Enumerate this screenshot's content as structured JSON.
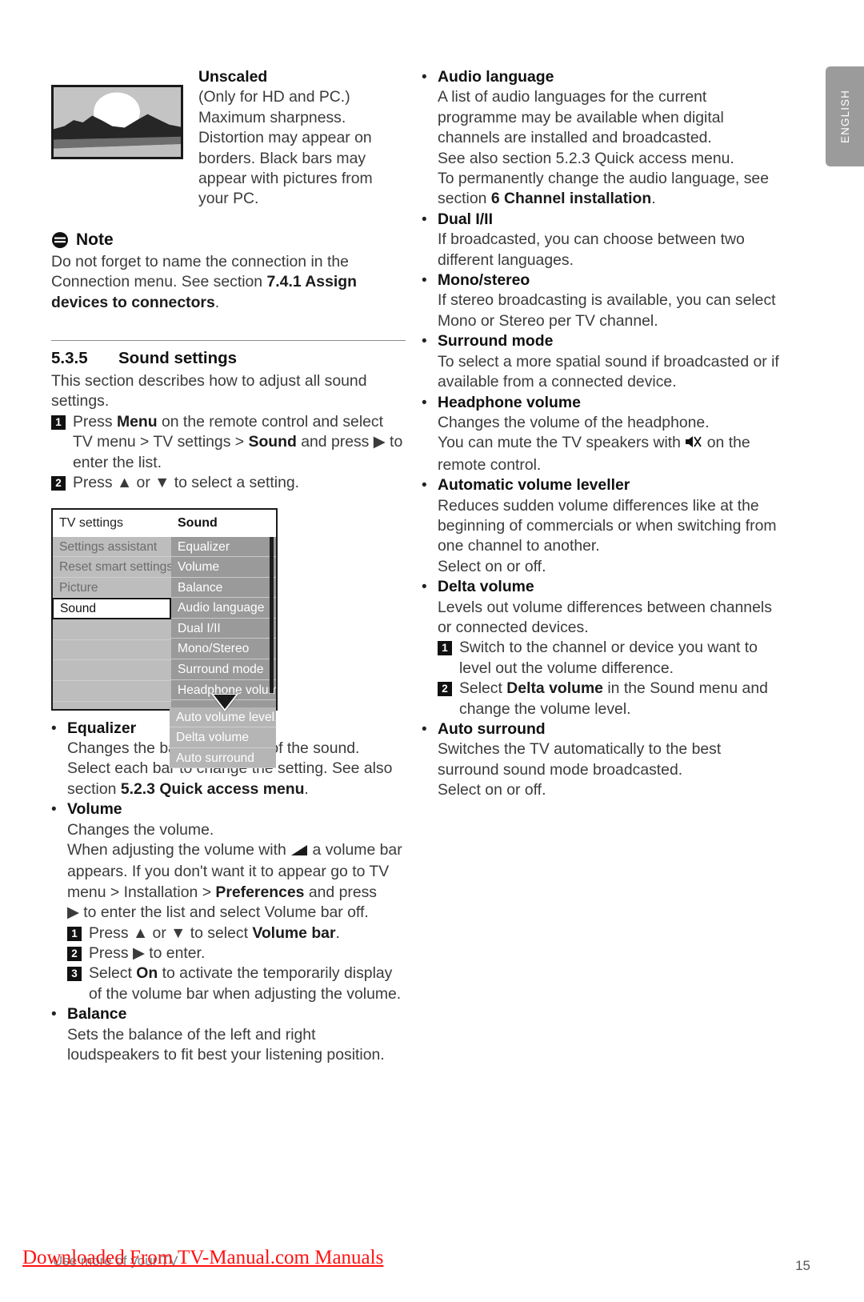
{
  "language_tab": {
    "label": "ENGLISH"
  },
  "left_column": {
    "unscaled": {
      "title": "Unscaled",
      "lines": [
        "(Only for HD and PC.)",
        "Maximum sharpness.",
        "Distortion may appear on",
        "borders. Black bars may",
        "appear with pictures from",
        "your PC."
      ]
    },
    "note": {
      "title": "Note",
      "text_before": "Do not forget to name the connection in the Connection menu. See section ",
      "text_bold": "7.4.1 Assign devices to connectors",
      "text_after": "."
    },
    "section": {
      "number": "5.3.5",
      "title": "Sound settings",
      "intro": "This section describes how to adjust all sound settings.",
      "steps": [
        {
          "num": "1",
          "parts": [
            {
              "t": "Press ",
              "b": false
            },
            {
              "t": "Menu",
              "b": true
            },
            {
              "t": " on the remote control and select TV menu > TV settings > ",
              "b": false
            },
            {
              "t": "Sound",
              "b": true
            },
            {
              "t": " and press ▶ to enter the list.",
              "b": false
            }
          ]
        },
        {
          "num": "2",
          "parts": [
            {
              "t": "Press ▲ or ▼ to select a setting.",
              "b": false
            }
          ]
        }
      ]
    },
    "menu_mock": {
      "header_left": "TV settings",
      "header_right": "Sound",
      "left_items": [
        {
          "label": "Settings assistant",
          "selected": false
        },
        {
          "label": "Reset smart settings",
          "selected": false
        },
        {
          "label": "Picture",
          "selected": false
        },
        {
          "label": "Sound",
          "selected": true
        }
      ],
      "right_items": [
        "Equalizer",
        "Volume",
        "Balance",
        "Audio language",
        "Dual I/II",
        "Mono/Stereo",
        "Surround mode",
        "Headphone volume"
      ],
      "overflow_items": [
        "Auto volume level...",
        "Delta volume",
        "Auto surround"
      ]
    },
    "bullets": [
      {
        "title": "Equalizer",
        "lines": [
          [
            {
              "t": "Changes the bass and treble of the sound. Select each bar to change the setting. See also section ",
              "b": false
            },
            {
              "t": "5.2.3 Quick access menu",
              "b": true
            },
            {
              "t": ".",
              "b": false
            }
          ]
        ]
      },
      {
        "title": "Volume",
        "lines": [
          [
            {
              "t": "Changes the volume.",
              "b": false
            }
          ],
          [
            {
              "t": "When adjusting the volume with ",
              "b": false
            },
            {
              "icon": "volume-wedge-icon"
            },
            {
              "t": " a volume bar appears. If you don't want it to appear go to TV menu > Installation > ",
              "b": false
            },
            {
              "t": "Preferences",
              "b": true
            },
            {
              "t": " and press",
              "b": false
            }
          ],
          [
            {
              "t": "▶ to enter the list and select Volume bar off.",
              "b": false
            }
          ]
        ],
        "steps": [
          {
            "num": "1",
            "parts": [
              {
                "t": "Press ▲ or ▼ to select ",
                "b": false
              },
              {
                "t": "Volume bar",
                "b": true
              },
              {
                "t": ".",
                "b": false
              }
            ]
          },
          {
            "num": "2",
            "parts": [
              {
                "t": "Press ▶ to enter.",
                "b": false
              }
            ]
          },
          {
            "num": "3",
            "parts": [
              {
                "t": "Select ",
                "b": false
              },
              {
                "t": "On",
                "b": true
              },
              {
                "t": " to activate the temporarily display of the volume bar when adjusting the volume.",
                "b": false
              }
            ]
          }
        ]
      },
      {
        "title": "Balance",
        "lines": [
          [
            {
              "t": "Sets the balance of the left and right loudspeakers to fit best your listening position.",
              "b": false
            }
          ]
        ]
      }
    ]
  },
  "right_column": {
    "bullets": [
      {
        "title": "Audio language",
        "lines": [
          [
            {
              "t": "A list of audio languages for the current programme may be available when digital channels are installed and broadcasted.",
              "b": false
            }
          ],
          [
            {
              "t": "See also section 5.2.3 Quick access menu.",
              "b": false
            }
          ],
          [
            {
              "t": "To permanently change the audio language, see section ",
              "b": false
            },
            {
              "t": "6 Channel installation",
              "b": true
            },
            {
              "t": ".",
              "b": false
            }
          ]
        ]
      },
      {
        "title": "Dual I/II",
        "lines": [
          [
            {
              "t": "If broadcasted, you can choose between two different languages.",
              "b": false
            }
          ]
        ]
      },
      {
        "title": "Mono/stereo",
        "lines": [
          [
            {
              "t": "If stereo broadcasting is available, you can select Mono or Stereo per TV channel.",
              "b": false
            }
          ]
        ]
      },
      {
        "title": "Surround mode",
        "lines": [
          [
            {
              "t": "To select a more spatial sound if broadcasted or if available from a connected device.",
              "b": false
            }
          ]
        ]
      },
      {
        "title": "Headphone volume",
        "lines": [
          [
            {
              "t": "Changes the volume of the headphone.",
              "b": false
            }
          ],
          [
            {
              "t": "You can mute the TV speakers with ",
              "b": false
            },
            {
              "icon": "mute-speaker-icon"
            },
            {
              "t": " on the remote control.",
              "b": false
            }
          ]
        ]
      },
      {
        "title": "Automatic volume leveller",
        "lines": [
          [
            {
              "t": "Reduces sudden volume differences like at the beginning of commercials or when switching from one channel to another.",
              "b": false
            }
          ],
          [
            {
              "t": "Select on or off.",
              "b": false
            }
          ]
        ]
      },
      {
        "title": "Delta volume",
        "lines": [
          [
            {
              "t": "Levels out volume differences between channels or connected devices.",
              "b": false
            }
          ]
        ],
        "steps": [
          {
            "num": "1",
            "parts": [
              {
                "t": "Switch to the channel or device you want to level out the volume difference.",
                "b": false
              }
            ]
          },
          {
            "num": "2",
            "parts": [
              {
                "t": "Select ",
                "b": false
              },
              {
                "t": "Delta volume",
                "b": true
              },
              {
                "t": " in the Sound menu and change the volume level.",
                "b": false
              }
            ]
          }
        ]
      },
      {
        "title": "Auto surround",
        "lines": [
          [
            {
              "t": "Switches the TV automatically to the best surround sound mode broadcasted.",
              "b": false
            }
          ],
          [
            {
              "t": "Select on or off.",
              "b": false
            }
          ]
        ]
      }
    ]
  },
  "footer": {
    "gray_text": "Use more of your TV",
    "watermark": "Downloaded From TV-Manual.com Manuals",
    "page_number": "15"
  },
  "colors": {
    "menu_left_bg": "#bdbdbd",
    "menu_right_bg": "#9a9a9a",
    "menu_overflow_bg": "#b5b5b5",
    "lang_tab_bg": "#9b9b9b",
    "watermark_red": "#ff1111"
  }
}
